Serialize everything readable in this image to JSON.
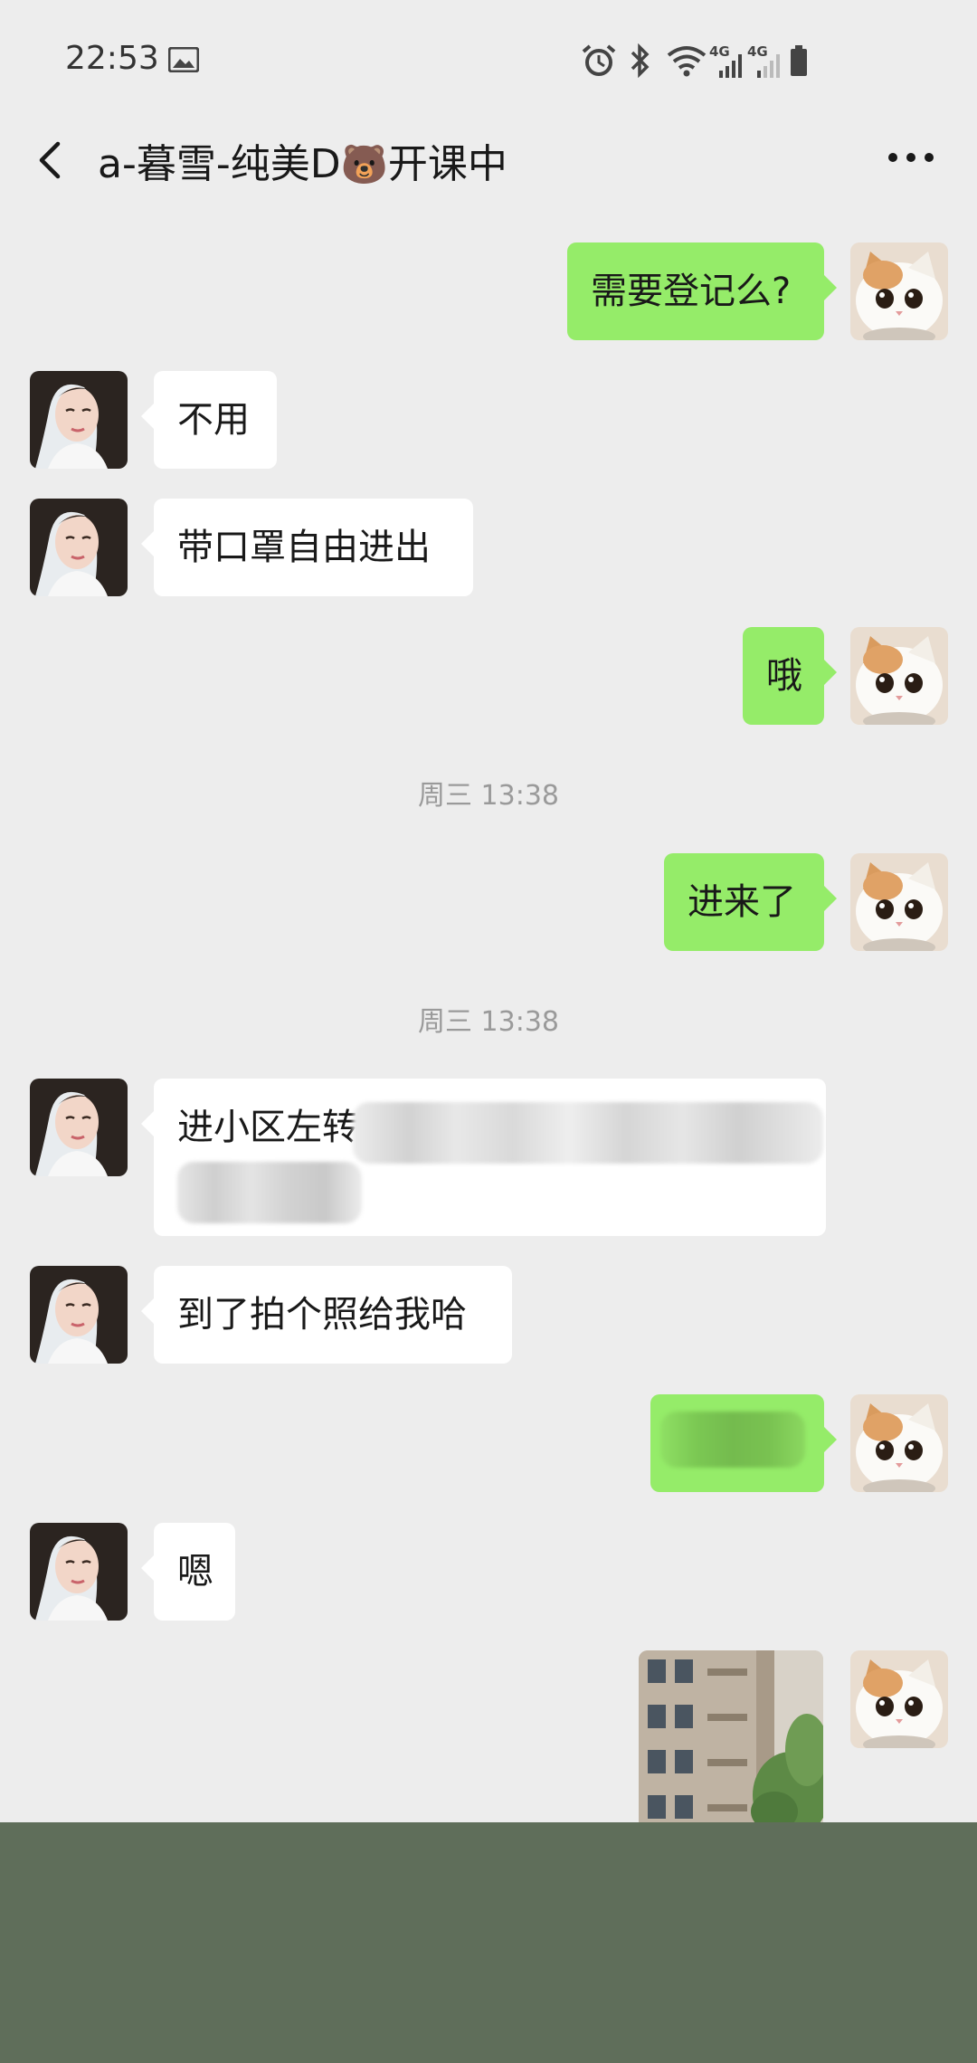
{
  "status_bar": {
    "time": "22:53",
    "icons": [
      "image-icon",
      "alarm-icon",
      "bluetooth-icon",
      "wifi-icon",
      "signal-4g-icon",
      "signal-4g-icon",
      "battery-icon"
    ],
    "network_labels": [
      "4G",
      "4G"
    ]
  },
  "header": {
    "title_prefix": "a-暮雪-纯美D",
    "title_emoji": "🐻",
    "title_suffix": "开课中"
  },
  "messages": [
    {
      "side": "right",
      "text": "需要登记么?"
    },
    {
      "side": "left",
      "text": "不用"
    },
    {
      "side": "left",
      "text": "带口罩自由进出"
    },
    {
      "side": "right",
      "text": "哦"
    },
    {
      "side": "time",
      "text": "周三 13:38"
    },
    {
      "side": "right",
      "text": "进来了"
    },
    {
      "side": "time",
      "text": "周三 13:38"
    },
    {
      "side": "left",
      "text": "进小区左转"
    },
    {
      "side": "left",
      "text": "到了拍个照给我哈"
    },
    {
      "side": "right",
      "text": ""
    },
    {
      "side": "left",
      "text": "嗯"
    },
    {
      "side": "right",
      "text": "",
      "type": "image"
    }
  ],
  "colors": {
    "background": "#ededed",
    "bubble_self": "#95ec69",
    "bubble_other": "#ffffff",
    "timestamp": "#9a9a9a",
    "bottom_panel": "#5f6e5a"
  }
}
